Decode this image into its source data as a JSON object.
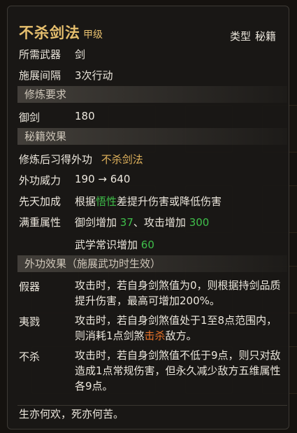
{
  "header": {
    "title": "不杀剑法",
    "grade": "甲级",
    "type_label": "类型",
    "type_value": "秘籍"
  },
  "basic": {
    "weapon_label": "所需武器",
    "weapon_value": "剑",
    "interval_label": "施展间隔",
    "interval_value": "3次行动"
  },
  "requirements": {
    "section_title": "修炼要求",
    "skill_label": "御剑",
    "skill_value": "180"
  },
  "book_effect": {
    "section_title": "秘籍效果",
    "learn_label": "修炼后习得外功",
    "learn_value": "不杀剑法",
    "power_label": "外功威力",
    "power_value": "190 → 640",
    "innate_label": "先天加成",
    "innate_pre": "根据",
    "innate_highlight": "悟性",
    "innate_post": "差提升伤害或降低伤害",
    "full_label": "满重属性",
    "full_a_pre": "御剑增加",
    "full_a_val": "37",
    "full_b_pre": "、攻击增加",
    "full_b_val": "300",
    "full_c_pre": "武学常识增加",
    "full_c_val": "60"
  },
  "external_effects": {
    "section_title": "外功效果（施展武功时生效）",
    "items": [
      {
        "name": "假器",
        "text": "攻击时，若自身剑煞值为0，则根据持剑品质提升伤害，最高可增加200%。"
      },
      {
        "name": "夷戮",
        "text_pre": "攻击时，若自身剑煞值处于1至8点范围内，则消耗1点剑煞",
        "text_highlight": "击杀",
        "text_post": "敌方。"
      },
      {
        "name": "不杀",
        "text": "攻击时，若自身剑煞值不低于9点，则只对敌造成1点常规伤害，但永久减少敌方五维属性各9点。"
      }
    ]
  },
  "quote": "生亦何欢，死亦何苦。"
}
